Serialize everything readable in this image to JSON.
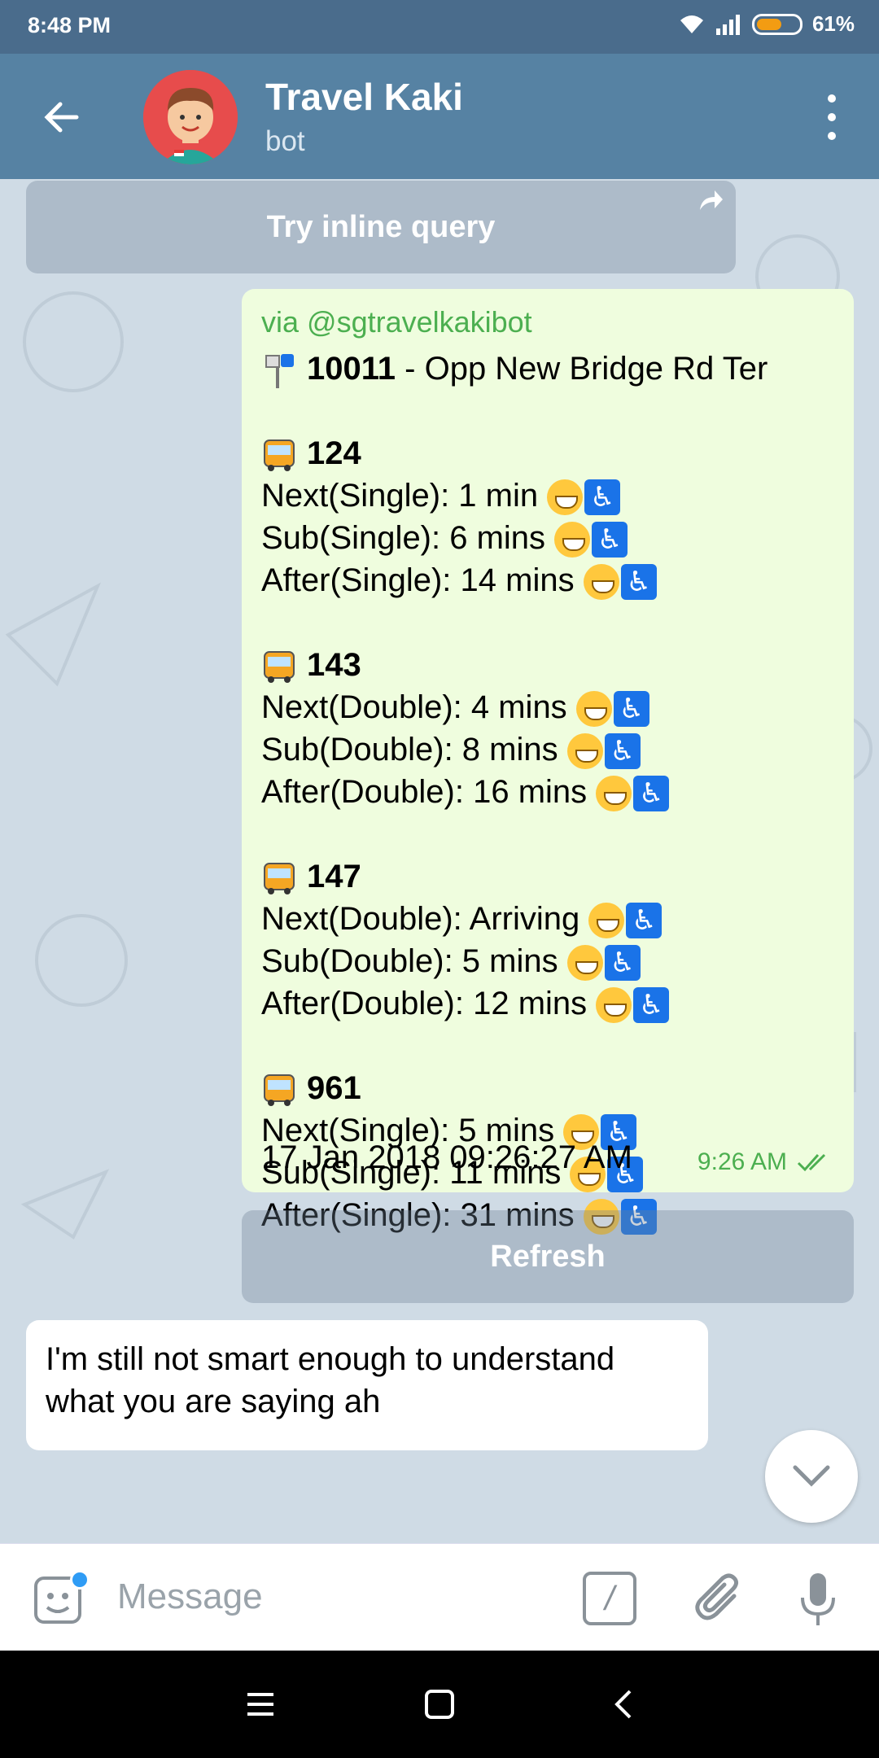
{
  "status": {
    "time": "8:48 PM",
    "battery": "61%"
  },
  "header": {
    "title": "Travel Kaki",
    "subtitle": "bot"
  },
  "chat": {
    "inline_button": "Try inline query",
    "message": {
      "via": "via @sgtravelkakibot",
      "stop_code": "10011",
      "stop_name": " - Opp New Bridge Rd Ter",
      "buses": [
        {
          "number": "124",
          "lines": [
            "Next(Single): 1 min",
            "Sub(Single): 6 mins",
            "After(Single): 14 mins"
          ]
        },
        {
          "number": "143",
          "lines": [
            "Next(Double): 4 mins",
            "Sub(Double): 8 mins",
            "After(Double): 16 mins"
          ]
        },
        {
          "number": "147",
          "lines": [
            "Next(Double): Arriving",
            "Sub(Double): 5 mins",
            "After(Double): 12 mins"
          ]
        },
        {
          "number": "961",
          "lines": [
            "Next(Single): 5 mins",
            "Sub(Single): 11 mins",
            "After(Single): 31 mins"
          ]
        }
      ],
      "datetime": "17 Jan 2018 09:26:27 AM",
      "time": "9:26 AM"
    },
    "refresh_button": "Refresh",
    "incoming_text": "I'm still not smart enough to understand what you are saying ah"
  },
  "input": {
    "placeholder": "Message",
    "cmd_label": "/"
  },
  "colors": {
    "header": "#5682a3",
    "status_bar": "#4a6c8c",
    "outgoing_bubble": "#effdde",
    "accent_green": "#4caf50"
  }
}
